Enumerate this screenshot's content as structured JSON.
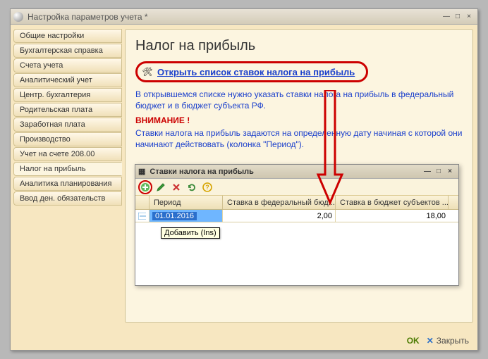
{
  "window": {
    "title": "Настройка параметров учета *"
  },
  "sidebar": {
    "items": [
      {
        "label": "Общие настройки"
      },
      {
        "label": "Бухгалтерская справка"
      },
      {
        "label": "Счета учета"
      },
      {
        "label": "Аналитический учет"
      },
      {
        "label": "Центр. бухгалтерия"
      },
      {
        "label": "Родительская плата"
      },
      {
        "label": "Заработная плата"
      },
      {
        "label": "Производство"
      },
      {
        "label": "Учет на счете 208.00"
      },
      {
        "label": "Налог на прибыль"
      },
      {
        "label": "Аналитика планирования"
      },
      {
        "label": "Ввод ден. обязательств"
      }
    ],
    "selected_index": 9
  },
  "main": {
    "title": "Налог на прибыль",
    "link_label": "Открыть список ставок налога на прибыль",
    "para1": "В открывшемся списке нужно указать ставки налога на прибыль в федеральный бюджет и в бюджет субъекта РФ.",
    "attention": "ВНИМАНИЕ !",
    "para2": "Ставки налога на прибыль задаются на определенную дату начиная с которой они начинают действовать (колонка \"Период\")."
  },
  "inner_window": {
    "title": "Ставки налога на прибыль",
    "tooltip": "Добавить (Ins)",
    "columns": {
      "col1": "Период",
      "col2": "Ставка в федеральный бюд...",
      "col3": "Ставка в бюджет субъектов ..."
    },
    "row": {
      "period": "01.01.2016",
      "fed": "2,00",
      "subj": "18,00"
    }
  },
  "chart_data": {
    "type": "table",
    "title": "Ставки налога на прибыль",
    "columns": [
      "Период",
      "Ставка в федеральный бюджет",
      "Ставка в бюджет субъектов"
    ],
    "rows": [
      [
        "01.01.2016",
        2.0,
        18.0
      ]
    ]
  },
  "footer": {
    "ok": "OK",
    "close": "Закрыть"
  }
}
